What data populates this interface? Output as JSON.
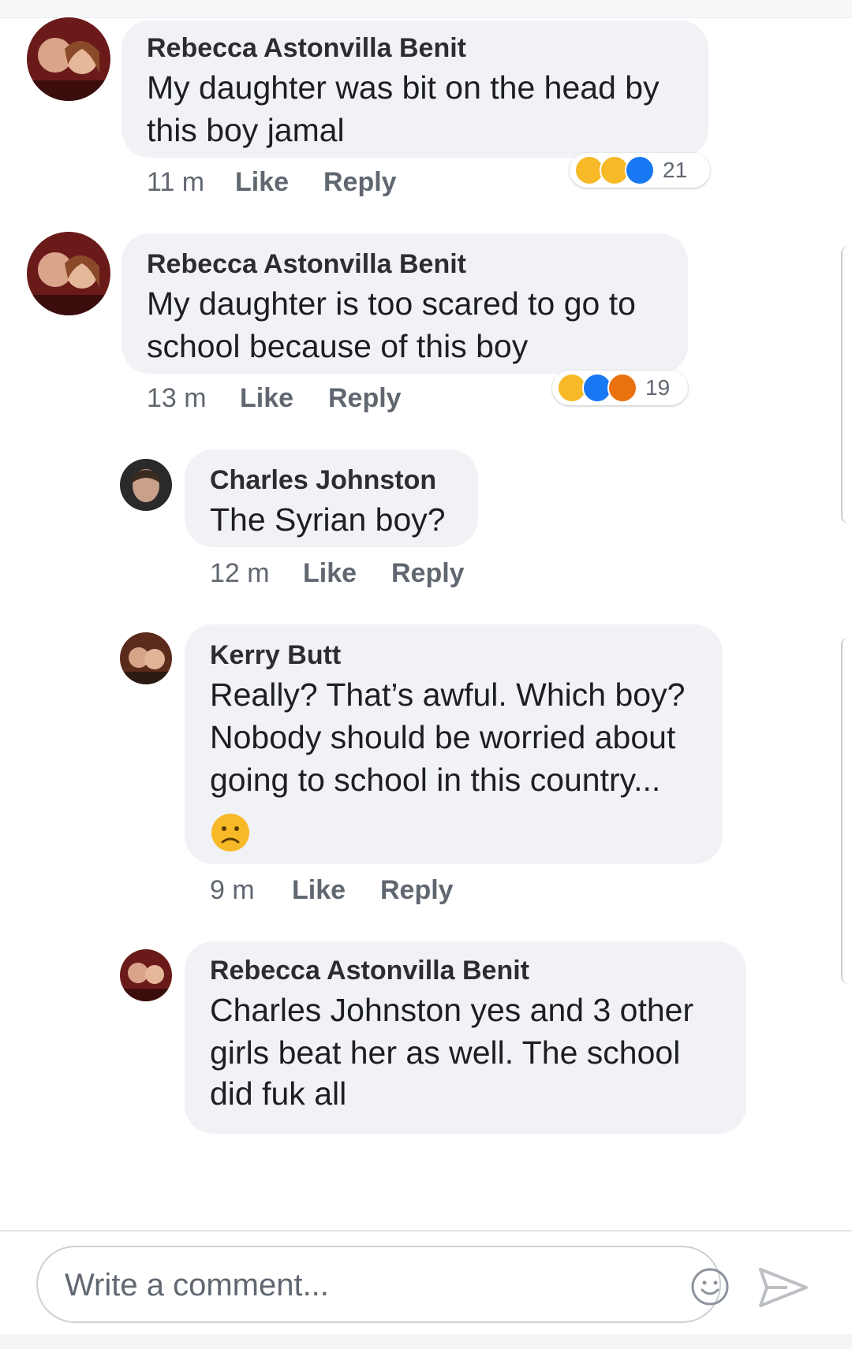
{
  "comments": [
    {
      "author": "Rebecca Astonvilla Benit",
      "lines": [
        "My daughter was bit on the head by",
        "this boy jamal"
      ],
      "time": "11 m",
      "like": "Like",
      "reply": "Reply",
      "reactions": {
        "icons": [
          "wow",
          "sad",
          "like"
        ],
        "count": "21"
      }
    },
    {
      "author": "Rebecca Astonvilla Benit",
      "lines": [
        "My daughter is too scared to go to",
        "school because of this boy"
      ],
      "time": "13 m",
      "like": "Like",
      "reply": "Reply",
      "reactions": {
        "icons": [
          "sad",
          "like",
          "angry"
        ],
        "count": "19"
      }
    },
    {
      "author": "Charles Johnston",
      "lines": [
        "The Syrian boy?"
      ],
      "time": "12 m",
      "like": "Like",
      "reply": "Reply"
    },
    {
      "author": "Kerry Butt",
      "lines": [
        "Really? That’s awful. Which boy?",
        "Nobody should be worried about",
        "going to school in this country..."
      ],
      "emoji": "sad-face-emoji",
      "time": "9 m",
      "like": "Like",
      "reply": "Reply"
    },
    {
      "author": "Rebecca Astonvilla Benit",
      "lines": [
        "Charles Johnston  yes and 3 other",
        "girls beat her as well. The school",
        "did fuk all"
      ]
    }
  ],
  "composer": {
    "placeholder": "Write a comment...",
    "emoji_icon": "smiley-icon",
    "send_icon": "send-icon"
  },
  "colors": {
    "bubble": "#f0f2f5",
    "like_blue": "#1877f2",
    "angry_red": "#e9710f",
    "emoji_yellow": "#f7b928"
  }
}
